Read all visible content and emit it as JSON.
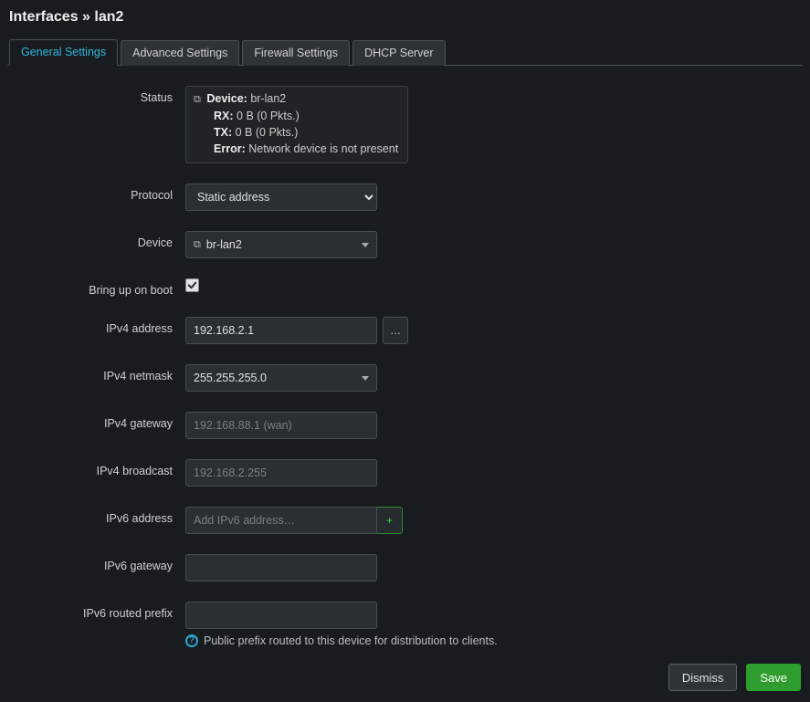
{
  "title": "Interfaces » lan2",
  "tabs": {
    "general": "General Settings",
    "advanced": "Advanced Settings",
    "firewall": "Firewall Settings",
    "dhcp": "DHCP Server"
  },
  "labels": {
    "status": "Status",
    "protocol": "Protocol",
    "device": "Device",
    "bringup": "Bring up on boot",
    "ipv4addr": "IPv4 address",
    "ipv4mask": "IPv4 netmask",
    "ipv4gw": "IPv4 gateway",
    "ipv4bc": "IPv4 broadcast",
    "ipv6addr": "IPv6 address",
    "ipv6gw": "IPv6 gateway",
    "ipv6prefix": "IPv6 routed prefix"
  },
  "status": {
    "deviceLabel": "Device:",
    "deviceValue": "br-lan2",
    "rxLabel": "RX:",
    "rxValue": "0 B (0 Pkts.)",
    "txLabel": "TX:",
    "txValue": "0 B (0 Pkts.)",
    "errorLabel": "Error:",
    "errorValue": "Network device is not present"
  },
  "fields": {
    "protocol": "Static address",
    "device": "br-lan2",
    "ipv4addr": "192.168.2.1",
    "ipv4mask": "255.255.255.0",
    "ipv4gw_placeholder": "192.168.88.1 (wan)",
    "ipv4bc_placeholder": "192.168.2.255",
    "ipv6addr_placeholder": "Add IPv6 address…",
    "more_btn": "…",
    "add_btn": "+"
  },
  "help": {
    "ipv6prefix": "Public prefix routed to this device for distribution to clients."
  },
  "buttons": {
    "dismiss": "Dismiss",
    "save": "Save"
  }
}
